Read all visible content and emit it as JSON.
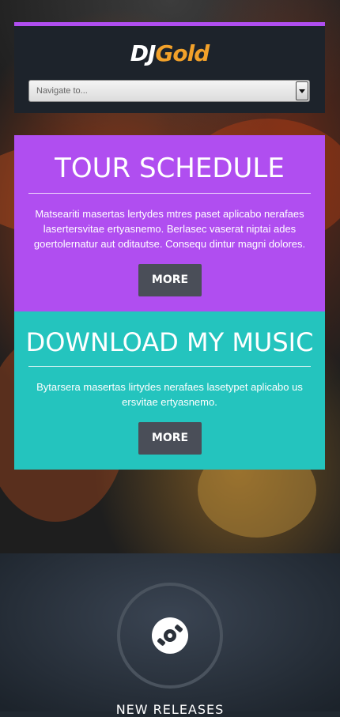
{
  "header": {
    "logo_part1": "DJ",
    "logo_part2": "Gold",
    "nav_placeholder": "Navigate to..."
  },
  "tour": {
    "title": "TOUR SCHEDULE",
    "text": "Matseariti masertas lertydes mtres paset aplicabo nerafaes lasertersvitae ertyasnemo. Berlasec vaserat niptai ades goertolernatur aut oditautse. Consequ dintur magni dolores.",
    "button": "MORE"
  },
  "music": {
    "title": "DOWNLOAD MY MUSIC",
    "text": "Bytarsera masertas lirtydes nerafaes lasetypet aplicabo us ersvitae ertyasnemo.",
    "button": "MORE"
  },
  "releases": {
    "label": "NEW RELEASES"
  },
  "colors": {
    "accent_purple": "#b04ef0",
    "accent_teal": "#24c4be",
    "logo_gold": "#f2a12a",
    "button_gray": "#4a4e58"
  },
  "icons": {
    "nav_arrow": "chevron-down-icon",
    "releases_icon": "disc-icon"
  }
}
